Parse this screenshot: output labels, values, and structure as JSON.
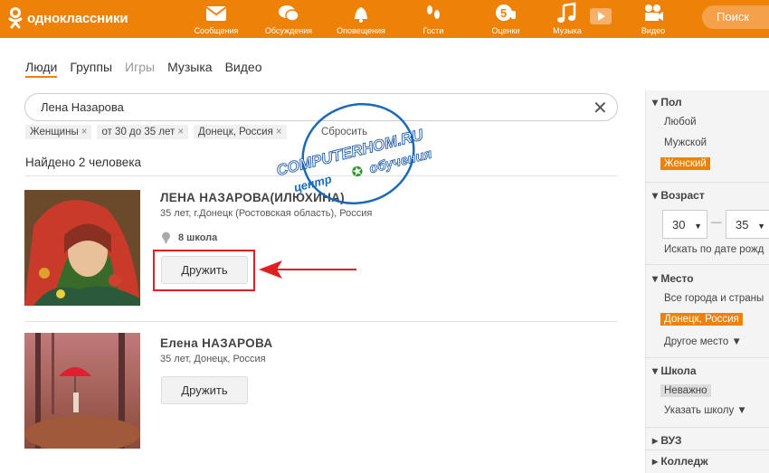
{
  "topbar": {
    "logo_text": "одноклассники",
    "nav": [
      {
        "label": "Сообщения",
        "icon": "envelope-icon"
      },
      {
        "label": "Обсуждения",
        "icon": "chat-icon"
      },
      {
        "label": "Оповещения",
        "icon": "bell-icon"
      },
      {
        "label": "Гости",
        "icon": "footprints-icon"
      },
      {
        "label": "Оценки",
        "icon": "rating-icon"
      },
      {
        "label": "Музыка",
        "icon": "music-note-icon"
      },
      {
        "label": "Видео",
        "icon": "video-camera-icon"
      }
    ],
    "search_button": "Поиск"
  },
  "tabs": [
    "Люди",
    "Группы",
    "Игры",
    "Музыка",
    "Видео"
  ],
  "search": {
    "value": "Лена Назарова"
  },
  "filters": [
    "Женщины",
    "от 30 до 35 лет",
    "Донецк, Россия"
  ],
  "reset_label": "Сбросить",
  "found_text": "Найдено 2 человека",
  "results": [
    {
      "name": "ЛЕНА НАЗАРОВА(ИЛЮХИНА)",
      "info": "35 лет, г.Донецк (Ростовская область), Россия",
      "school": "8 школа",
      "button": "Дружить"
    },
    {
      "name": "Елена НАЗАРОВА",
      "info": "35 лет, Донецк, Россия",
      "button": "Дружить"
    }
  ],
  "sidebar": {
    "gender": {
      "title": "Пол",
      "options": [
        "Любой",
        "Мужской",
        "Женский"
      ],
      "selected": "Женский"
    },
    "age": {
      "title": "Возраст",
      "from": "30",
      "to": "35",
      "dash": "—",
      "note": "Искать по дате рожд"
    },
    "place": {
      "title": "Место",
      "all": "Все города и страны",
      "selected": "Донецк, Россия",
      "other": "Другое место ▼"
    },
    "school": {
      "title": "Школа",
      "selected": "Неважно",
      "other": "Указать школу ▼"
    },
    "vuz": {
      "title": "ВУЗ"
    },
    "college": {
      "title": "Колледж"
    }
  },
  "watermark": {
    "line1": "COMPUTERHOM.RU",
    "line2a": "центр",
    "line2b": "обучения"
  },
  "colors": {
    "brand": "#ee8208",
    "highlight": "#e02020"
  }
}
